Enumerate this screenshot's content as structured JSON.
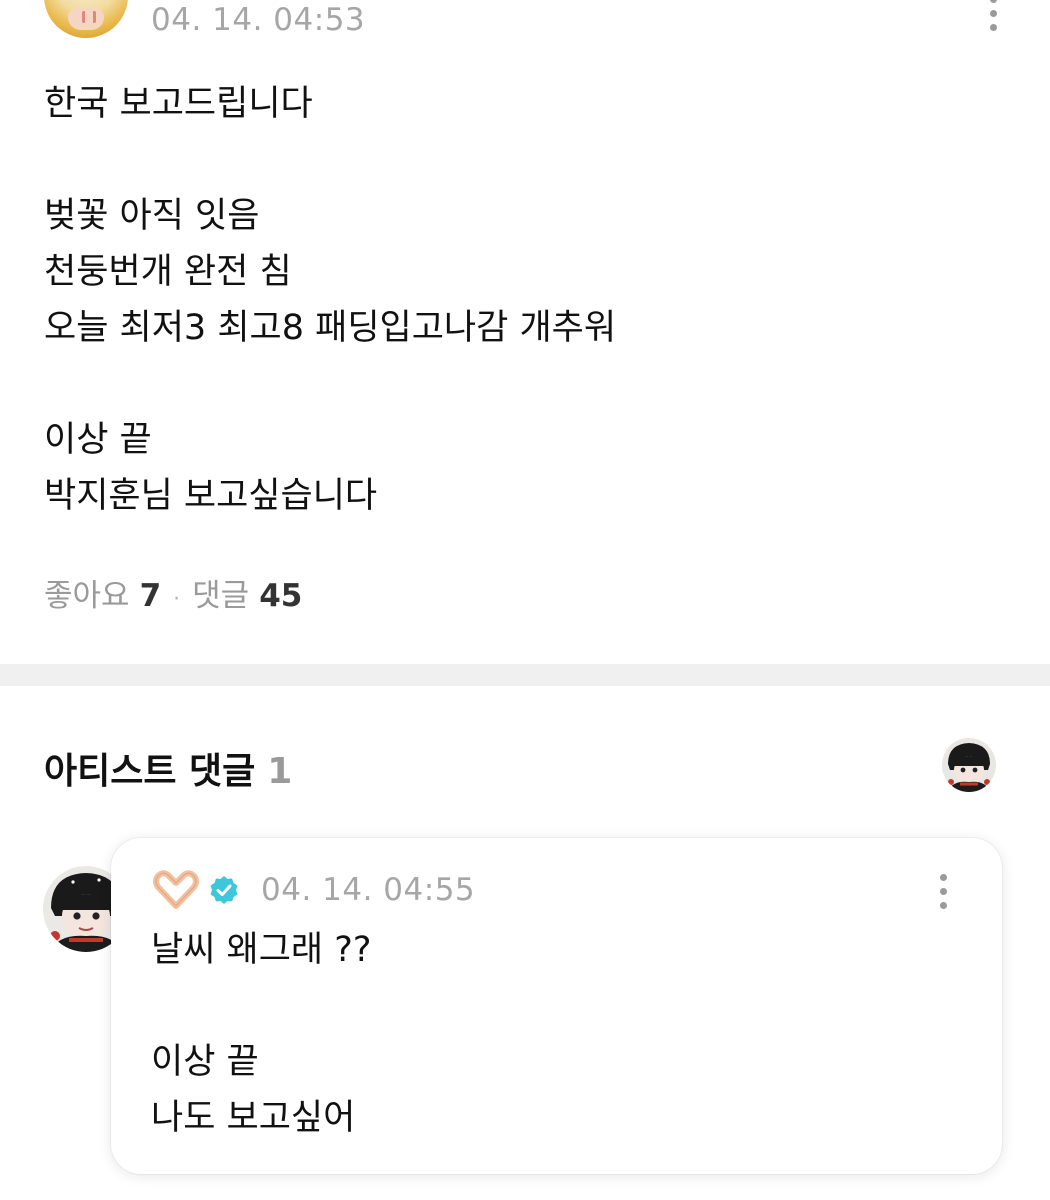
{
  "post": {
    "timestamp": "04. 14. 04:53",
    "body": "한국 보고드립니다\n\n벚꽃 아직 잇음\n천둥번개 완전 침\n오늘 최저3 최고8 패딩입고나감 개추워\n\n이상 끝\n박지훈님 보고싶습니다",
    "likes_label": "좋아요",
    "likes_count": "7",
    "comments_label": "댓글",
    "comments_count": "45",
    "separator": "·"
  },
  "artist_comments": {
    "title": "아티스트 댓글",
    "count": "1"
  },
  "comment": {
    "timestamp": "04. 14. 04:55",
    "body": "날씨 왜그래 ??\n\n이상 끝\n나도 보고싶어",
    "badge_color": "#3ec6dc",
    "icons": [
      "heart-hands-emoji",
      "verified-badge-icon",
      "more-options-icon"
    ]
  },
  "colors": {
    "muted_text": "#a6a6a6",
    "divider": "#f0f0f0",
    "text": "#111111"
  }
}
